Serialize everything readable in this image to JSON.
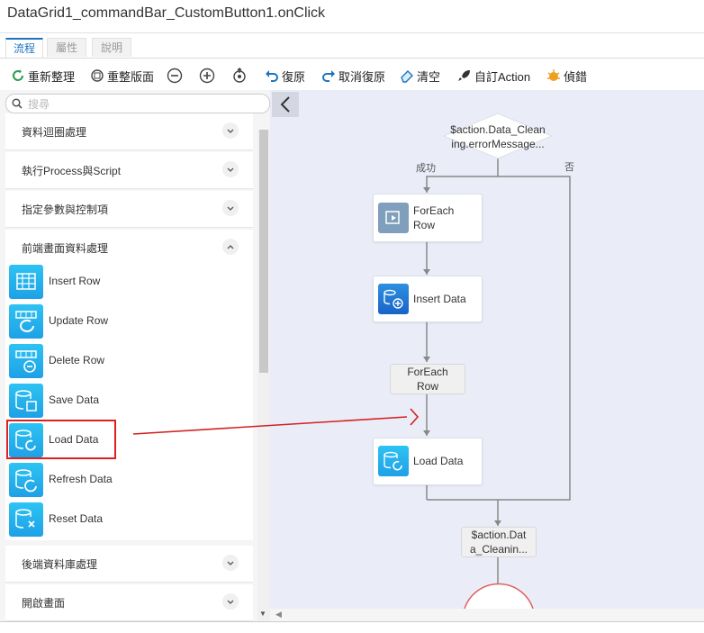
{
  "window": {
    "title": "DataGrid1_commandBar_CustomButton1.onClick"
  },
  "tabs": [
    {
      "label": "流程",
      "active": true
    },
    {
      "label": "屬性",
      "active": false
    },
    {
      "label": "說明",
      "active": false
    }
  ],
  "toolbar": {
    "reorganize": "重新整理",
    "relayout": "重整版面",
    "undo": "復原",
    "redo": "取消復原",
    "clear": "清空",
    "custom_action": "自訂Action",
    "debug": "偵錯"
  },
  "sidebar": {
    "search_placeholder": "搜尋",
    "groups": [
      {
        "label": "資料迴圈處理"
      },
      {
        "label": "執行Process與Script"
      },
      {
        "label": "指定參數與控制項"
      },
      {
        "label": "前端畫面資料處理"
      },
      {
        "label": "後端資料庫處理"
      },
      {
        "label": "開啟畫面"
      }
    ],
    "items": [
      {
        "label": "Insert Row",
        "icon": "table-icon"
      },
      {
        "label": "Update Row",
        "icon": "table-refresh-icon"
      },
      {
        "label": "Delete Row",
        "icon": "table-delete-icon"
      },
      {
        "label": "Save Data",
        "icon": "database-save-icon"
      },
      {
        "label": "Load Data",
        "icon": "database-load-icon"
      },
      {
        "label": "Refresh Data",
        "icon": "database-refresh-icon"
      },
      {
        "label": "Reset Data",
        "icon": "database-reset-icon"
      }
    ]
  },
  "flow": {
    "decision_line1": "$action.Data_Clean",
    "decision_line2": "ing.errorMessage...",
    "success_label": "成功",
    "no_label": "否",
    "foreach_line1": "ForEach",
    "foreach_line2": "Row",
    "insert_data": "Insert Data",
    "foreach_end_line1": "ForEach",
    "foreach_end_line2": "Row",
    "load_data": "Load Data",
    "action_line1": "$action.Dat",
    "action_line2": "a_Cleanin..."
  },
  "colors": {
    "accent": "#1e73be",
    "highlight": "#e02020",
    "canvas": "#eaedf8",
    "icon": "#1ea1e6"
  }
}
